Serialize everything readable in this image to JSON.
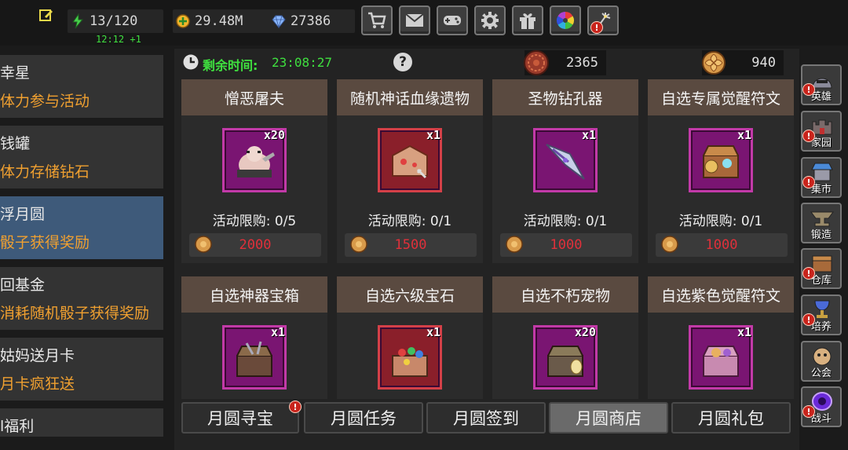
{
  "topbar": {
    "stamina": "13/120",
    "regen": "12:12 +1",
    "gold": "29.48M",
    "gems": "27386",
    "buttons": [
      "shop-cart-icon",
      "mail-icon",
      "gamepad-icon",
      "settings-gear-icon",
      "gift-icon",
      "color-wheel-icon",
      "firework-icon"
    ]
  },
  "sidebar": {
    "items": [
      {
        "title": "幸星",
        "desc": "体力参与活动"
      },
      {
        "title": "钱罐",
        "desc": "体力存储钻石"
      },
      {
        "title": "浮月圆",
        "desc": "骰子获得奖励"
      },
      {
        "title": "回基金",
        "desc": "消耗随机骰子获得奖励"
      },
      {
        "title": "姑妈送月卡",
        "desc": "月卡疯狂送"
      },
      {
        "title": "l福利",
        "desc": ""
      }
    ]
  },
  "header": {
    "timer_label": "剩余时间:",
    "timer_value": "23:08:27",
    "help": "?",
    "currency1": "2365",
    "currency2": "940"
  },
  "items": [
    {
      "name": "憎恶屠夫",
      "qty": "x20",
      "limit": "活动限购: 0/5",
      "price": "2000",
      "icon": "butcher-hero-icon"
    },
    {
      "name": "随机神话血缘遗物",
      "qty": "x1",
      "limit": "活动限购: 0/1",
      "price": "1500",
      "icon": "relic-chest-icon"
    },
    {
      "name": "圣物钻孔器",
      "qty": "x1",
      "limit": "活动限购: 0/1",
      "price": "1000",
      "icon": "drill-icon"
    },
    {
      "name": "自选专属觉醒符文",
      "qty": "x1",
      "limit": "活动限购: 0/1",
      "price": "1000",
      "icon": "rune-chest-icon"
    },
    {
      "name": "自选神器宝箱",
      "qty": "x1",
      "icon": "artifact-chest-icon"
    },
    {
      "name": "自选六级宝石",
      "qty": "x1",
      "icon": "gem-chest-icon"
    },
    {
      "name": "自选不朽宠物",
      "qty": "x20",
      "icon": "pet-chest-icon"
    },
    {
      "name": "自选紫色觉醒符文",
      "qty": "x1",
      "icon": "purple-rune-chest-icon"
    }
  ],
  "tabs": [
    "月圆寻宝",
    "月圆任务",
    "月圆签到",
    "月圆商店",
    "月圆礼包"
  ],
  "rightnav": [
    "英雄",
    "家园",
    "集市",
    "锻造",
    "仓库",
    "培养",
    "公会",
    "战斗"
  ]
}
